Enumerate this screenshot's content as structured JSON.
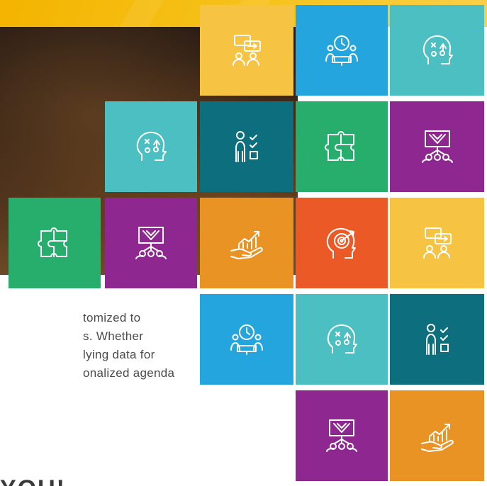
{
  "text_lines": [
    "tomized to",
    "s. Whether",
    "lying data for",
    "onalized agenda"
  ],
  "partial_heading": "YOU!",
  "colors": {
    "yellow": "#f6c342",
    "blue": "#25a5de",
    "teal": "#4bbfc2",
    "dark_teal": "#0d6f7d",
    "green": "#27ae6c",
    "purple": "#8e278f",
    "orange": "#e89324",
    "red_orange": "#eb5a26"
  },
  "tiles": [
    {
      "color": "yellow",
      "icon": "chat-group-icon"
    },
    {
      "color": "blue",
      "icon": "meeting-clock-icon"
    },
    {
      "color": "teal",
      "icon": "strategy-head-icon"
    },
    {
      "color": "teal",
      "icon": "strategy-head-icon"
    },
    {
      "color": "dark_teal",
      "icon": "checklist-person-icon"
    },
    {
      "color": "green",
      "icon": "puzzle-icon"
    },
    {
      "color": "purple",
      "icon": "presentation-network-icon"
    },
    {
      "color": "green",
      "icon": "puzzle-icon"
    },
    {
      "color": "purple",
      "icon": "presentation-network-icon"
    },
    {
      "color": "orange",
      "icon": "growth-hand-icon"
    },
    {
      "color": "red_orange",
      "icon": "target-head-icon"
    },
    {
      "color": "yellow",
      "icon": "chat-group-icon"
    },
    {
      "color": "blue",
      "icon": "meeting-clock-icon"
    },
    {
      "color": "teal",
      "icon": "strategy-head-icon"
    },
    {
      "color": "dark_teal",
      "icon": "checklist-person-icon"
    },
    {
      "color": "purple",
      "icon": "presentation-network-icon"
    },
    {
      "color": "orange",
      "icon": "growth-hand-icon"
    }
  ]
}
